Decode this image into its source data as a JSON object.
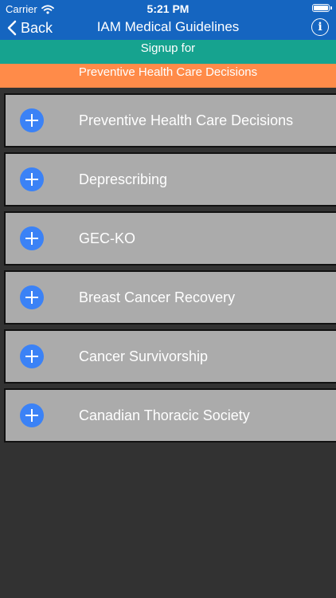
{
  "status_bar": {
    "carrier": "Carrier",
    "time": "5:21 PM"
  },
  "nav": {
    "back_label": "Back",
    "title": "IAM Medical Guidelines",
    "info_label": "i"
  },
  "banner": {
    "signup_label": "Signup for",
    "selected_guideline": "Preventive Health Care Decisions"
  },
  "guidelines": [
    {
      "label": "Preventive Health Care Decisions"
    },
    {
      "label": "Deprescribing"
    },
    {
      "label": "GEC-KO"
    },
    {
      "label": "Breast Cancer Recovery"
    },
    {
      "label": "Cancer Survivorship"
    },
    {
      "label": "Canadian Thoracic Society"
    }
  ],
  "colors": {
    "nav_background": "#1565c0",
    "signup_band": "#16a38f",
    "selected_band": "#ff8b49",
    "row_background": "#ababab",
    "add_icon": "#3b82f6",
    "page_background": "#323232"
  },
  "icons": {
    "add": "plus-circle-icon",
    "back": "chevron-left-icon",
    "info": "info-circle-icon"
  }
}
